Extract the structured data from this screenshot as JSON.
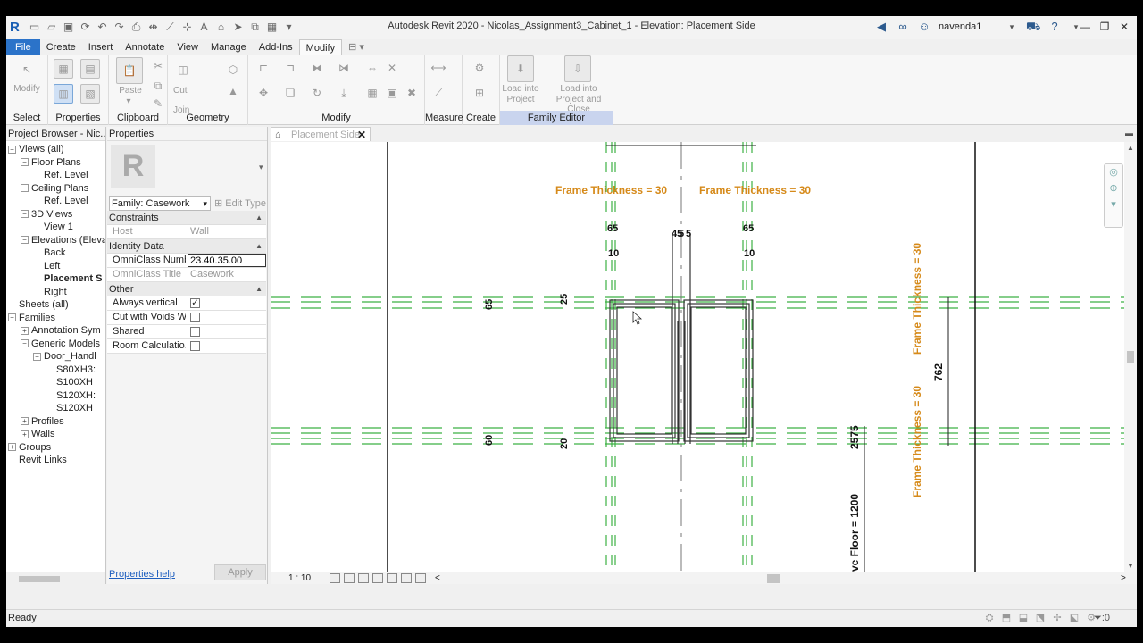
{
  "titlebar": {
    "title": "Autodesk Revit 2020 - Nicolas_Assignment3_Cabinet_1 - Elevation: Placement Side",
    "user": "navenda1",
    "logo": "R"
  },
  "menu": {
    "tabs": [
      "File",
      "Create",
      "Insert",
      "Annotate",
      "View",
      "Manage",
      "Add-Ins",
      "Modify"
    ]
  },
  "ribbon": {
    "groups": {
      "select": "Select",
      "properties": "Properties",
      "clipboard": "Clipboard",
      "geometry": "Geometry",
      "modify": "Modify",
      "measure": "Measure",
      "create": "Create",
      "family_editor": "Family Editor"
    },
    "labels": {
      "modify": "Modify",
      "paste": "Paste",
      "cut": "Cut",
      "join": "Join",
      "load_into_project_1": "Load into",
      "load_into_project_2": "Project",
      "load_close_1": "Load into",
      "load_close_2": "Project and Close"
    }
  },
  "project_browser": {
    "title": "Project Browser - Nic...",
    "items": [
      {
        "label": "Views (all)",
        "level": 0,
        "toggle": "−"
      },
      {
        "label": "Floor Plans",
        "level": 1,
        "toggle": "−"
      },
      {
        "label": "Ref. Level",
        "level": 2,
        "toggle": ""
      },
      {
        "label": "Ceiling Plans",
        "level": 1,
        "toggle": "−"
      },
      {
        "label": "Ref. Level",
        "level": 2,
        "toggle": ""
      },
      {
        "label": "3D Views",
        "level": 1,
        "toggle": "−"
      },
      {
        "label": "View 1",
        "level": 2,
        "toggle": ""
      },
      {
        "label": "Elevations (Eleva",
        "level": 1,
        "toggle": "−"
      },
      {
        "label": "Back",
        "level": 2,
        "toggle": ""
      },
      {
        "label": "Left",
        "level": 2,
        "toggle": ""
      },
      {
        "label": "Placement S",
        "level": 2,
        "toggle": "",
        "bold": true
      },
      {
        "label": "Right",
        "level": 2,
        "toggle": ""
      },
      {
        "label": "Sheets (all)",
        "level": 0,
        "toggle": ""
      },
      {
        "label": "Families",
        "level": 0,
        "toggle": "−"
      },
      {
        "label": "Annotation Sym",
        "level": 1,
        "toggle": "+"
      },
      {
        "label": "Generic Models",
        "level": 1,
        "toggle": "−"
      },
      {
        "label": "Door_Handl",
        "level": 2,
        "toggle": "−"
      },
      {
        "label": "S80XH3:",
        "level": 3,
        "toggle": ""
      },
      {
        "label": "S100XH",
        "level": 3,
        "toggle": ""
      },
      {
        "label": "S120XH:",
        "level": 3,
        "toggle": ""
      },
      {
        "label": "S120XH",
        "level": 3,
        "toggle": ""
      },
      {
        "label": "Profiles",
        "level": 1,
        "toggle": "+"
      },
      {
        "label": "Walls",
        "level": 1,
        "toggle": "+"
      },
      {
        "label": "Groups",
        "level": 0,
        "toggle": "+"
      },
      {
        "label": "Revit Links",
        "level": 0,
        "toggle": ""
      }
    ]
  },
  "properties": {
    "title": "Properties",
    "family_selector": "Family: Casework",
    "edit_type": "Edit Type",
    "image_letter": "R",
    "sections": {
      "constraints": "Constraints",
      "identity": "Identity Data",
      "other": "Other"
    },
    "rows": {
      "host_k": "Host",
      "host_v": "Wall",
      "omni_num_k": "OmniClass Numb...",
      "omni_num_v": "23.40.35.00",
      "omni_title_k": "OmniClass Title",
      "omni_title_v": "Casework",
      "always_vertical_k": "Always vertical",
      "cut_voids_k": "Cut with Voids W...",
      "shared_k": "Shared",
      "room_calc_k": "Room Calculatio..."
    },
    "checks": {
      "always_vertical": "✓",
      "cut_voids": "",
      "shared": "",
      "room_calc": ""
    },
    "help": "Properties help",
    "apply": "Apply"
  },
  "view": {
    "tab_label": "Placement Side",
    "scale": "1 : 10",
    "annotations": {
      "frame_left": "Frame Thickness = 30",
      "frame_right": "Frame Thickness = 30",
      "frame_vert_top": "Frame Thickness = 30",
      "frame_vert_bottom": "Frame Thickness = 30",
      "d65_left": "65",
      "d45": "45",
      "d5a": "5",
      "d5b": "5",
      "d65_right": "65",
      "d10_left": "10",
      "d10_right": "10",
      "d65_vert": "65",
      "d25": "25",
      "d60": "60",
      "d20": "20",
      "d762": "762",
      "d2575": "2575",
      "floor": "ve Floor = 1200"
    }
  },
  "status": {
    "text": "Ready",
    "filter": ":0"
  },
  "colors": {
    "accent": "#2b73c9",
    "dimension_orange": "#d68a1a",
    "ref_plane_green": "#3cb043",
    "family_editor_band": "#c9d4ee"
  }
}
